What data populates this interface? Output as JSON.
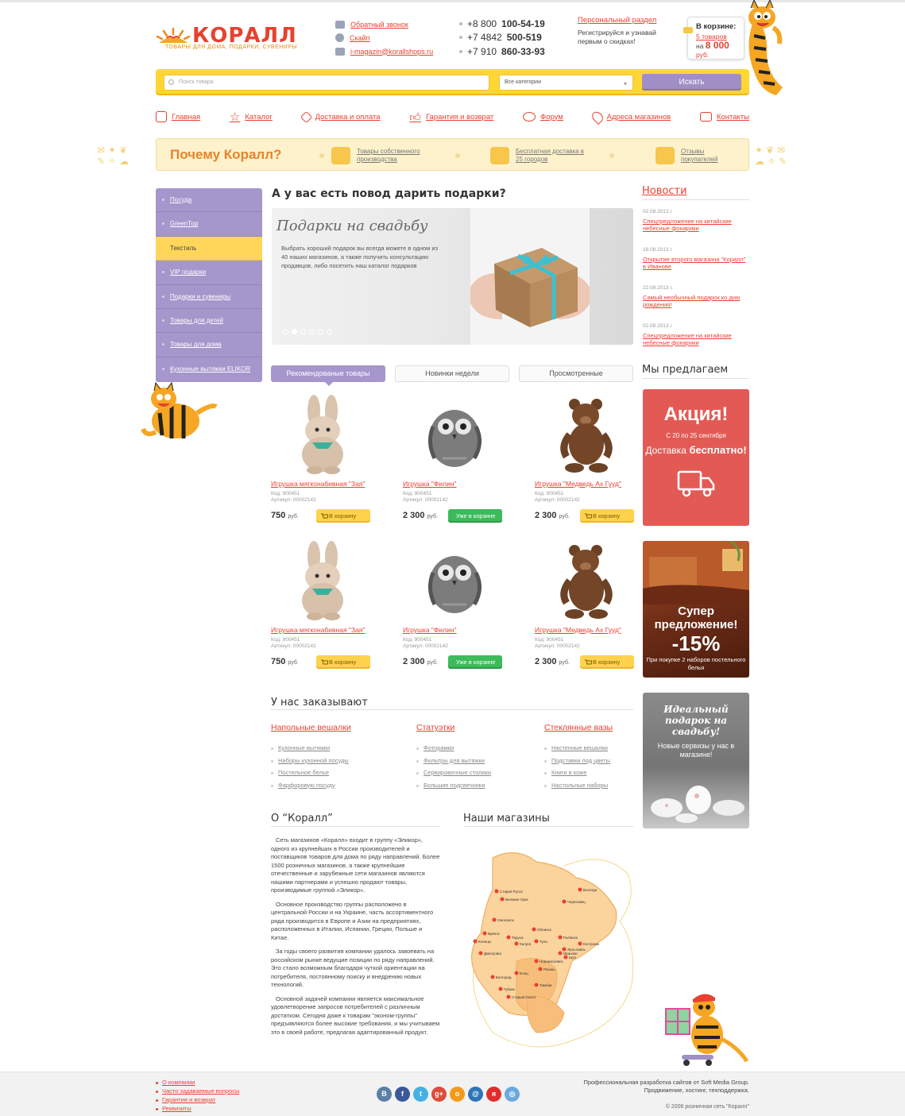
{
  "header": {
    "logo": "КОРАЛЛ",
    "logo_sub": "ТОВАРЫ ДЛЯ ДОМА, ПОДАРКИ, СУВЕНИРЫ",
    "contacts": [
      "Обратный звонок",
      "Скайп",
      "i-magazin@korallshops.ru"
    ],
    "phones": [
      {
        "prefix": "+8 800",
        "num": "100-54-19"
      },
      {
        "prefix": "+7 4842",
        "num": "500-519"
      },
      {
        "prefix": "+7 910",
        "num": "860-33-93"
      }
    ],
    "personal_link": "Персональный раздел",
    "personal_text": "Регистрируйся и узнавай первым о скидках!",
    "cart": {
      "title": "В корзине:",
      "count": "5 товаров",
      "sum_label": "на",
      "sum": "8 000",
      "currency": "руб."
    }
  },
  "search": {
    "placeholder": "Поиск товара",
    "category": "Все категории",
    "button": "Искать"
  },
  "nav": [
    "Главная",
    "Каталог",
    "Доставка и оплата",
    "Гарантия и возврат",
    "Форум",
    "Адреса магазинов",
    "Контакты"
  ],
  "why": {
    "title": "Почему Коралл?",
    "items": [
      "Товары собственного производства",
      "Бесплатная доставка в 25 городов",
      "Отзывы покупателей"
    ]
  },
  "sidebar": [
    "Посуда",
    "GreenТор",
    "Текстиль",
    "VIP подарки",
    "Подарки  и сувениры",
    "Товары для детей",
    "Товары для дома",
    "Кухонные вытяжки ELIKOR"
  ],
  "main": {
    "heading": "А у вас есть повод дарить подарки?",
    "slide_title": "Подарки на свадьбу",
    "slide_text": "Выбрать хороший подарок вы всегда можете в одном из 40 наших магазинов, а также получить консультацию продавцов, либо посетить наш каталог подарков",
    "tabs": [
      "Рекомендованые товары",
      "Новинки недели",
      "Просмотренные"
    ]
  },
  "products": [
    {
      "name": "Игрушка мягконабивная \"Зая\"",
      "code": "Код:  900451",
      "article": "Артикул:  00002142",
      "price": "750",
      "cur": "руб.",
      "btn": "В корзину",
      "in_cart": false
    },
    {
      "name": "Игрушка \"Филин\"",
      "code": "Код:  900451",
      "article": "Артикул:  00002142",
      "price": "2 300",
      "cur": "руб.",
      "btn": "Уже в корзине",
      "in_cart": true
    },
    {
      "name": "Игрушка \"Медведь Ах Гууд\"",
      "code": "Код:  900451",
      "article": "Артикул:  00002142",
      "price": "2 300",
      "cur": "руб.",
      "btn": "В корзину",
      "in_cart": false
    },
    {
      "name": "Игрушка мягконабивная \"Зая\"",
      "code": "Код:  900451",
      "article": "Артикул:  00002142",
      "price": "750",
      "cur": "руб.",
      "btn": "В корзину",
      "in_cart": false
    },
    {
      "name": "Игрушка \"Филин\"",
      "code": "Код:  900451",
      "article": "Артикул:  00002142",
      "price": "2 300",
      "cur": "руб.",
      "btn": "Уже в корзине",
      "in_cart": true
    },
    {
      "name": "Игрушка \"Медведь Ах Гууд\"",
      "code": "Код:  900451",
      "article": "Артикул:  00002142",
      "price": "2 300",
      "cur": "руб.",
      "btn": "В корзину",
      "in_cart": false
    }
  ],
  "ordered": {
    "heading": "У нас заказывают",
    "columns": [
      {
        "title": "Напольные вешалки",
        "items": [
          "Кухонные вытяжки",
          "Наборы кухонной посуды",
          "Постельное белье",
          "Фарфоровую посуду"
        ]
      },
      {
        "title": "Статуэтки",
        "items": [
          "Фоторамки",
          "Фильтры для вытяжки",
          "Сервировочные столики",
          "Большие подсвечники"
        ]
      },
      {
        "title": "Стеклянные вазы",
        "items": [
          "Настенные вешалки",
          "Подставки под цветы",
          "Книги в коже",
          "Настольные наборы"
        ]
      }
    ]
  },
  "about": {
    "heading": "О “Коралл”",
    "paragraphs": [
      "Сеть магазинов «Коралл» входит в группу «Эликор», одного из крупнейших в России производителей и поставщиков товаров для дома по ряду направлений. Более 1500 розничных магазинов, а также крупнейшие отечественные и зарубежные сети магазинов являются нашими партнерами и успешно продают товары, производимые группой «Эликор».",
      "Основное производство группы расположено в центральной России и на Украине, часть ассортиментного ряда производится в Европе и Азии на предприятиях, расположенных в Италии, Испании, Греции, Польше и Китае.",
      "За годы своего развития компании удалось завоевать на российском рынке ведущие позиции по ряду направлений. Это стало возможным благодаря чуткой ориентации на потребителя, постоянному поиску и внедрению новых технологий.",
      "Основной задачей компании является максимальное удовлетворение запросов потребителей с различным достатком. Сегодня даже к товарам \"эконом-группы\" предъявляются более высокие требования, и мы учитываем это в своей работе, предлагая адаптированный продукт."
    ]
  },
  "stores": {
    "heading": "Наши магазины",
    "cities": [
      "Старая Русса",
      "Великие Луки",
      "Череповец",
      "Вологда",
      "Смоленск",
      "Обнинск",
      "Рыбинск",
      "Ярославль",
      "Кострома",
      "Брянск",
      "Тула",
      "Иваново",
      "Шуя",
      "Калуга",
      "Таруса",
      "Новомосковск",
      "Рязань",
      "Клинцы",
      "Дмитровск",
      "Елец",
      "Тамбов",
      "Белгород",
      "Губкин",
      "Старый Оскол"
    ]
  },
  "news": {
    "heading": "Новости",
    "items": [
      {
        "date": "02.08.2013 г.",
        "text": "Спецпредложение на китайские небесные фонарики"
      },
      {
        "date": "18.08.2013 г.",
        "text": "Открытие второго магазина \"Коралл\" в Иванове"
      },
      {
        "date": "22.08.2013 г.",
        "text": "Самый необычный подарок ко дню рождения!"
      },
      {
        "date": "02.08.2013 г.",
        "text": "Спецпредложение на китайские небесные фонарики"
      }
    ]
  },
  "offers": {
    "heading": "Мы предлагаем",
    "promo1": {
      "title": "Акция!",
      "dates": "С 20 по 25 сентября",
      "text_a": "Доставка",
      "text_b": "бесплатно!"
    },
    "promo2": {
      "title": "Супер предложение!",
      "percent": "-15%",
      "text": "При покупке 2 наборов постельного белья"
    },
    "promo3": {
      "title": "Идеальный подарок на свадьбу!",
      "text": "Новые сервизы у нас в магазине!"
    }
  },
  "footer": {
    "links": [
      "О компании",
      "Часто задаваемые вопросы",
      "Гарантия и возврат",
      "Реквизиты"
    ],
    "socials": [
      "В",
      "f",
      "t",
      "g+",
      "о",
      "@",
      "я",
      "◎"
    ],
    "dev_text": "Профессиональная разработка сайтов от Soft Media Group. Продвижение, хостинг, техподдержка.",
    "copyright": "© 2006 розничная сеть \"Коралл\""
  },
  "colors": {
    "accent": "#e8412f",
    "yellow": "#ffd633",
    "purple": "#a596cc",
    "green": "#3dbb5b",
    "orange_title": "#e7832a"
  }
}
